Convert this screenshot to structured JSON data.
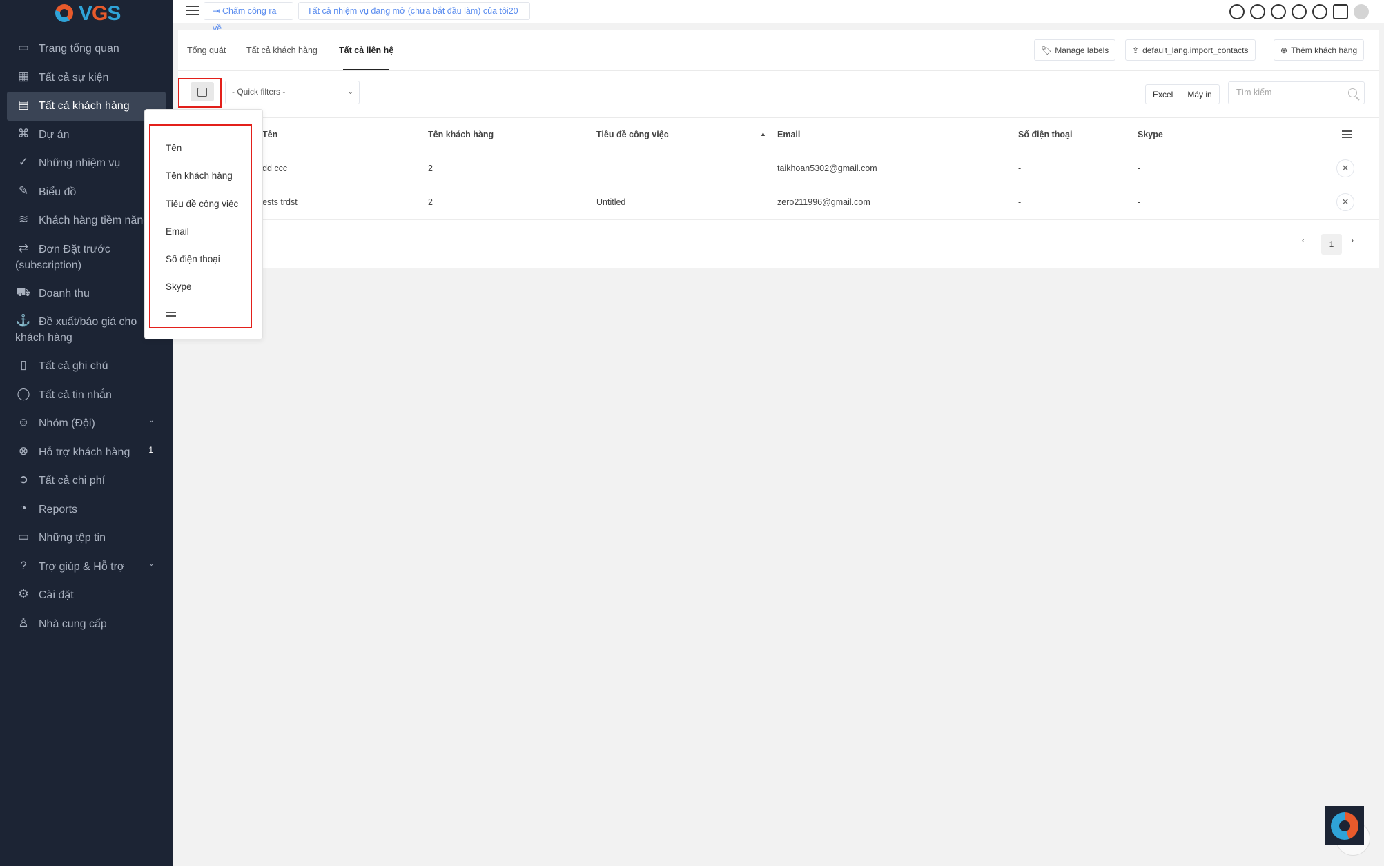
{
  "brand": {
    "logo_text_main": "VGS"
  },
  "sidebar": {
    "items": [
      {
        "label": "Trang tổng quan",
        "icon": "monitor-icon"
      },
      {
        "label": "Tất cả sự kiện",
        "icon": "calendar-icon"
      },
      {
        "label": "Tất cả khách hàng",
        "icon": "briefcase-icon",
        "active": true
      },
      {
        "label": "Dự án",
        "icon": "command-icon"
      },
      {
        "label": "Những nhiệm vụ",
        "icon": "check-circle-icon"
      },
      {
        "label": "Biểu đồ",
        "icon": "pen-tool-icon"
      },
      {
        "label": "Khách hàng tiềm năng",
        "icon": "layers-icon"
      },
      {
        "label": "Đơn Đặt trước",
        "label2": "(subscription)",
        "icon": "repeat-icon"
      },
      {
        "label": "Doanh thu",
        "icon": "cart-icon"
      },
      {
        "label": "Đề xuất/báo giá cho",
        "label2": "khách hàng",
        "icon": "anchor-icon"
      },
      {
        "label": "Tất cả ghi chú",
        "icon": "book-icon"
      },
      {
        "label": "Tất cả tin nhắn",
        "icon": "message-icon"
      },
      {
        "label": "Nhóm (Đội)",
        "icon": "users-icon",
        "chevron": true
      },
      {
        "label": "Hỗ trợ khách hàng",
        "icon": "lifebuoy-icon",
        "badge": "1"
      },
      {
        "label": "Tất cả chi phí",
        "icon": "arrow-circle-icon"
      },
      {
        "label": "Reports",
        "icon": "pie-chart-icon"
      },
      {
        "label": "Những tệp tin",
        "icon": "folder-icon"
      },
      {
        "label": "Trợ giúp & Hỗ trợ",
        "icon": "help-circle-icon",
        "chevron": true
      },
      {
        "label": "Cài đặt",
        "icon": "settings-icon"
      },
      {
        "label": "Nhà cung cấp",
        "icon": "user-icon"
      }
    ]
  },
  "topbar": {
    "clock_out": "Chấm công ra về",
    "open_tasks": "Tất cả nhiệm vụ đang mở (chưa bắt đầu làm) của tôi20",
    "icons": [
      "search-icon",
      "plus-circle-icon",
      "globe-icon",
      "clock-icon",
      "bell-icon",
      "mail-icon",
      "avatar"
    ]
  },
  "tabs": [
    {
      "label": "Tổng quát"
    },
    {
      "label": "Tất cả khách hàng"
    },
    {
      "label": "Tất cả liên hệ",
      "active": true
    }
  ],
  "actions": {
    "manage_labels": "Manage labels",
    "import_contacts": "default_lang.import_contacts",
    "add_client": "Thêm khách hàng"
  },
  "filters": {
    "quick_filters": "- Quick filters -",
    "excel": "Excel",
    "print": "Máy in",
    "search_placeholder": "Tìm kiếm"
  },
  "table": {
    "headers": [
      "Tên",
      "Tên khách hàng",
      "Tiêu đề công việc",
      "Email",
      "Số điện thoại",
      "Skype"
    ],
    "rows": [
      {
        "name": "dd ccc",
        "client": "2",
        "job_title": "",
        "email": "taikhoan5302@gmail.com",
        "phone": "-",
        "skype": "-"
      },
      {
        "name": "ests trdst",
        "client": "2",
        "job_title": "Untitled",
        "email": "zero211996@gmail.com",
        "phone": "-",
        "skype": "-"
      }
    ],
    "page": "1"
  },
  "column_menu": {
    "items": [
      "Tên",
      "Tên khách hàng",
      "Tiêu đề công việc",
      "Email",
      "Số điện thoại",
      "Skype"
    ]
  },
  "colors": {
    "sidebar_bg": "#1c2434",
    "highlight": "#e3201b",
    "link": "#5b8def"
  }
}
